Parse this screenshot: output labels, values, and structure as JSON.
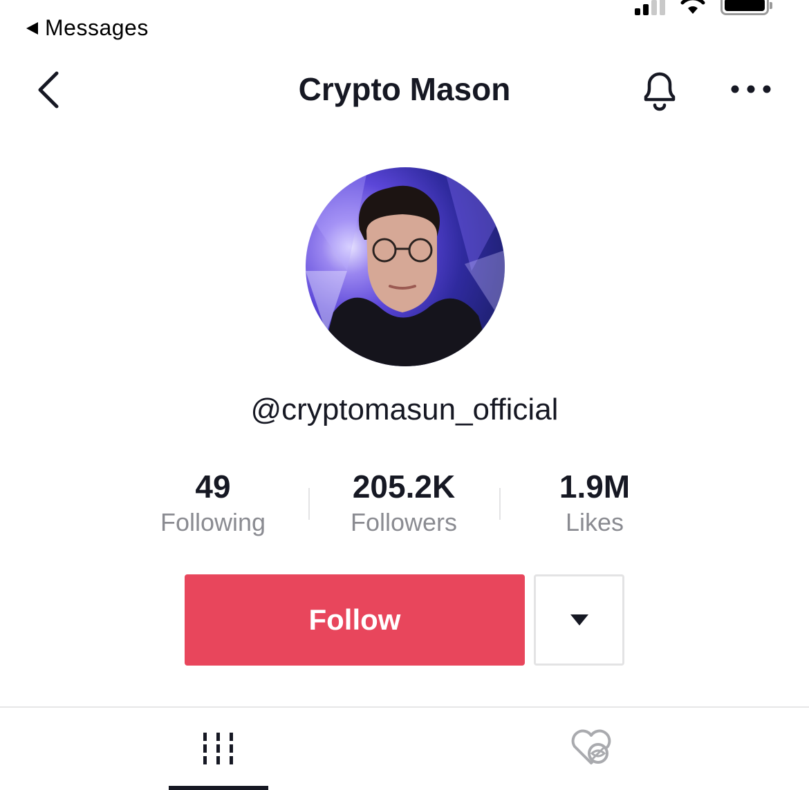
{
  "status_bar": {
    "back_app_label": "Messages"
  },
  "nav": {
    "title": "Crypto Mason"
  },
  "profile": {
    "handle": "@cryptomasun_official"
  },
  "stats": [
    {
      "value": "49",
      "label": "Following"
    },
    {
      "value": "205.2K",
      "label": "Followers"
    },
    {
      "value": "1.9M",
      "label": "Likes"
    }
  ],
  "actions": {
    "follow_label": "Follow"
  },
  "tabs": [
    {
      "icon": "grid-icon",
      "selected": true
    },
    {
      "icon": "hidden-liked-icon",
      "selected": false
    }
  ],
  "colors": {
    "follow_button": "#e8465c",
    "primary_text": "#161823",
    "secondary_text": "#8a8b91"
  }
}
